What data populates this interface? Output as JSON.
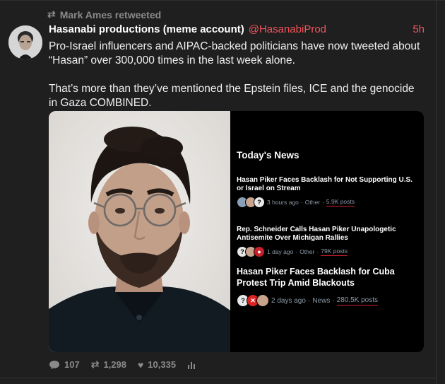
{
  "retweet": {
    "icon": "retweet-icon",
    "text": "Mark Ames retweeted"
  },
  "tweet": {
    "author_name": "Hasanabi productions (meme account)",
    "author_handle": "@HasanabiProd",
    "time": "5h",
    "paragraphs": [
      "Pro-Israel influencers and AIPAC-backed politicians have now tweeted about “Hasan” over 300,000 times in the last week alone.",
      "That’s more than they’ve mentioned the Epstein files, ICE and the genocide in Gaza COMBINED."
    ]
  },
  "media": {
    "news_title": "Today's News",
    "items": [
      {
        "headline": "Hasan Piker Faces Backlash for Not Supporting U.S. or Israel on Stream",
        "age": "3 hours ago",
        "category": "Other",
        "posts": "5.9K posts"
      },
      {
        "headline": "Rep. Schneider Calls Hasan Piker Unapologetic Antisemite Over Michigan Rallies",
        "age": "1 day ago",
        "category": "Other",
        "posts": "79K posts"
      },
      {
        "headline": "Hasan Piker Faces Backlash for Cuba Protest Trip Amid Blackouts",
        "age": "2 days ago",
        "category": "News",
        "posts": "280.5K posts"
      }
    ],
    "separator": "·"
  },
  "actions": {
    "replies": "107",
    "retweets": "1,298",
    "likes": "10,335"
  },
  "colors": {
    "accent": "#f2545b",
    "background": "#1f1f1f",
    "muted": "#8a8a8a",
    "underline": "#d0202b"
  }
}
